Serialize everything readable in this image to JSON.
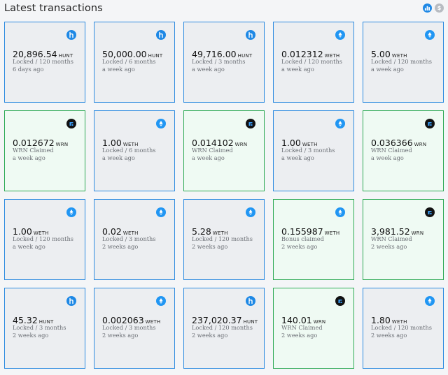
{
  "header": {
    "title": "Latest transactions",
    "chart_icon": "chart-icon",
    "dollar_icon": "dollar-icon",
    "dollar_glyph": "$"
  },
  "colors": {
    "lock_border": "#2d8be0",
    "claim_border": "#2eaa55",
    "lock_bg": "#eceef1",
    "claim_bg": "#effaf3"
  },
  "cards": [
    {
      "amount": "20,896.54",
      "symbol": "HUNT",
      "status": "Locked / 120 months",
      "time": "6 days ago",
      "token": "hunt",
      "kind": "lock"
    },
    {
      "amount": "50,000.00",
      "symbol": "HUNT",
      "status": "Locked / 6 months",
      "time": "a week ago",
      "token": "hunt",
      "kind": "lock"
    },
    {
      "amount": "49,716.00",
      "symbol": "HUNT",
      "status": "Locked / 3 months",
      "time": "a week ago",
      "token": "hunt",
      "kind": "lock"
    },
    {
      "amount": "0.012312",
      "symbol": "WETH",
      "status": "Locked / 120 months",
      "time": "a week ago",
      "token": "weth",
      "kind": "lock"
    },
    {
      "amount": "5.00",
      "symbol": "WETH",
      "status": "Locked / 120 months",
      "time": "a week ago",
      "token": "weth",
      "kind": "lock"
    },
    {
      "amount": "0.012672",
      "symbol": "WRN",
      "status": "WRN Claimed",
      "time": "a week ago",
      "token": "wrn",
      "kind": "claim"
    },
    {
      "amount": "1.00",
      "symbol": "WETH",
      "status": "Locked / 6 months",
      "time": "a week ago",
      "token": "weth",
      "kind": "lock"
    },
    {
      "amount": "0.014102",
      "symbol": "WRN",
      "status": "WRN Claimed",
      "time": "a week ago",
      "token": "wrn",
      "kind": "claim"
    },
    {
      "amount": "1.00",
      "symbol": "WETH",
      "status": "Locked / 3 months",
      "time": "a week ago",
      "token": "weth",
      "kind": "lock"
    },
    {
      "amount": "0.036366",
      "symbol": "WRN",
      "status": "WRN Claimed",
      "time": "a week ago",
      "token": "wrn",
      "kind": "claim"
    },
    {
      "amount": "1.00",
      "symbol": "WETH",
      "status": "Locked / 120 months",
      "time": "a week ago",
      "token": "weth",
      "kind": "lock"
    },
    {
      "amount": "0.02",
      "symbol": "WETH",
      "status": "Locked / 3 months",
      "time": "2 weeks ago",
      "token": "weth",
      "kind": "lock"
    },
    {
      "amount": "5.28",
      "symbol": "WETH",
      "status": "Locked / 120 months",
      "time": "2 weeks ago",
      "token": "weth",
      "kind": "lock"
    },
    {
      "amount": "0.155987",
      "symbol": "WETH",
      "status": "Bonus claimed",
      "time": "2 weeks ago",
      "token": "weth",
      "kind": "claim"
    },
    {
      "amount": "3,981.52",
      "symbol": "WRN",
      "status": "WRN Claimed",
      "time": "2 weeks ago",
      "token": "wrn",
      "kind": "claim"
    },
    {
      "amount": "45.32",
      "symbol": "HUNT",
      "status": "Locked / 3 months",
      "time": "2 weeks ago",
      "token": "hunt",
      "kind": "lock"
    },
    {
      "amount": "0.002063",
      "symbol": "WETH",
      "status": "Locked / 3 months",
      "time": "2 weeks ago",
      "token": "weth",
      "kind": "lock"
    },
    {
      "amount": "237,020.37",
      "symbol": "HUNT",
      "status": "Locked / 120 months",
      "time": "2 weeks ago",
      "token": "hunt",
      "kind": "lock"
    },
    {
      "amount": "140.01",
      "symbol": "WRN",
      "status": "WRN Claimed",
      "time": "2 weeks ago",
      "token": "wrn",
      "kind": "claim"
    },
    {
      "amount": "1.80",
      "symbol": "WETH",
      "status": "Locked / 120 months",
      "time": "2 weeks ago",
      "token": "weth",
      "kind": "lock"
    }
  ]
}
